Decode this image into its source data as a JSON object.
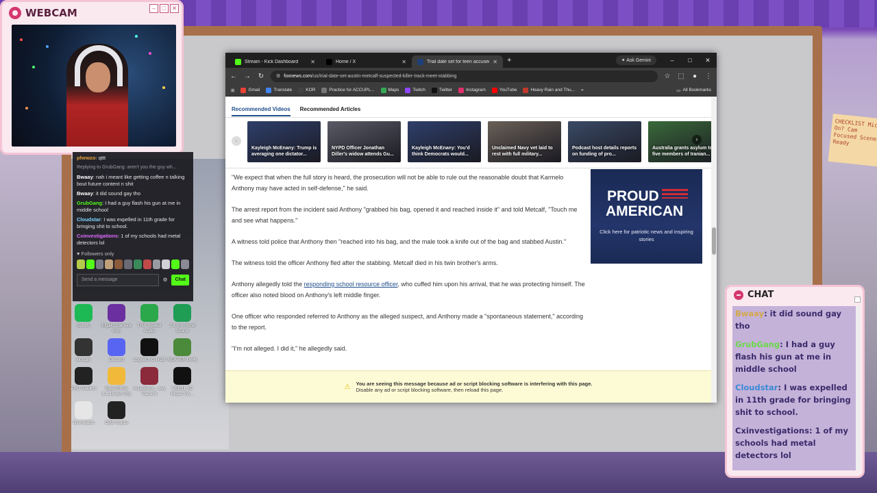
{
  "webcam": {
    "title": "WEBCAM"
  },
  "obs_chat": {
    "messages": [
      {
        "user": "phewzo",
        "text": "qttt",
        "color": "#e9a23b"
      },
      {
        "reply": "Replying to GrubGang: aren't you the guy wh..."
      },
      {
        "user": "Bwaay",
        "text": "nah i meant like getting coffee n talking bout future content n shit",
        "color": "#ffffff"
      },
      {
        "user": "Bwaay",
        "text": "it did sound gay tho",
        "color": "#ffffff"
      },
      {
        "user": "GrubGang",
        "text": "I had a guy flash his gun at me in middle school",
        "color": "#53fc18"
      },
      {
        "user": "Cloudstar",
        "text": "I was expelled in 11th grade for bringing shit to school.",
        "color": "#7fd6ff"
      },
      {
        "user": "Cxinvestigations",
        "text": "1 of my schools had metal detectors lol",
        "color": "#e06bff"
      }
    ],
    "followers_only": "Followers only",
    "send_placeholder": "Send a message",
    "chat_button": "Chat"
  },
  "desktop_icons": [
    {
      "label": "Spotify",
      "color": "#1db954"
    },
    {
      "label": "Elgato Camera Hub",
      "color": "#6b2fa0"
    },
    {
      "label": "THX Spatial Audio",
      "color": "#2aa84a"
    },
    {
      "label": "7.1 Surround Sound",
      "color": "#1f9d55"
    },
    {
      "label": "kicktalk",
      "color": "#333"
    },
    {
      "label": "Discord",
      "color": "#5865f2"
    },
    {
      "label": "Logitech G HUB",
      "color": "#111"
    },
    {
      "label": "REAPER (x64)",
      "color": "#4a8a3a"
    },
    {
      "label": "ARC Raiders",
      "color": "#222"
    },
    {
      "label": "OpenOffice 4.1.16 (en-US)",
      "color": "#f0b93a"
    },
    {
      "label": "re:jackbox... any Pack III",
      "color": "#8a2a3a"
    },
    {
      "label": "VBE31 3D Music Vis...",
      "color": "#111"
    },
    {
      "label": "Overwatch",
      "color": "#e6e6e6"
    },
    {
      "label": "OBS Studio",
      "color": "#222"
    }
  ],
  "browser": {
    "tabs": [
      {
        "label": "Stream - Kick Dashboard",
        "fav": "#53fc18"
      },
      {
        "label": "Home / X",
        "fav": "#000000"
      },
      {
        "label": "Trial date set for teen accused",
        "fav": "#1f3f7a"
      }
    ],
    "new_tab": "+",
    "ask_gemini": "Ask Gemini",
    "url_host": "foxnews.com",
    "url_path": "/us/trial-date-set-austin-metcalf-suspected-killer-track-meet-stabbing",
    "bookmarks": [
      {
        "label": "Gmail",
        "color": "#ea4335"
      },
      {
        "label": "Translate",
        "color": "#4285f4"
      },
      {
        "label": "KOR",
        "color": "#444"
      },
      {
        "label": "Practice for ACCUPL...",
        "color": "#777"
      },
      {
        "label": "Maps",
        "color": "#34a853"
      },
      {
        "label": "Twitch",
        "color": "#9146ff"
      },
      {
        "label": "Twitter",
        "color": "#111"
      },
      {
        "label": "Instagram",
        "color": "#e1306c"
      },
      {
        "label": "YouTube",
        "color": "#ff0000"
      },
      {
        "label": "Heavy Rain and Thu...",
        "color": "#c0392b"
      }
    ],
    "all_bookmarks": "All Bookmarks"
  },
  "page": {
    "rec_tabs": [
      "Recommended Videos",
      "Recommended Articles"
    ],
    "videos": [
      {
        "caption": "Kayleigh McEnany: Trump is averaging one dictator...",
        "color": "#2f3f6a"
      },
      {
        "caption": "NYPD Officer Jonathan Diller's widow attends Gu...",
        "color": "#5a5a66"
      },
      {
        "caption": "Kayleigh McEnany: You'd think Democrats would...",
        "color": "#2f3f6a"
      },
      {
        "caption": "Unclaimed Navy vet laid to rest with full military...",
        "color": "#6a6058"
      },
      {
        "caption": "Podcast host details reports on funding of pro...",
        "color": "#3a4a66"
      },
      {
        "caption": "Australia grants asylum to five members of Iranian...",
        "color": "#3a6a3a"
      }
    ],
    "paragraphs": [
      "\"We expect that when the full story is heard, the prosecution will not be able to rule out the reasonable doubt that Karmelo Anthony may have acted in self-defense,\" he said.",
      "The arrest report from the incident said Anthony \"grabbed his bag, opened it and reached inside it\" and told Metcalf, \"Touch me and see what happens.\"",
      "A witness told police that Anthony then \"reached into his bag, and the male took a knife out of the bag and stabbed Austin.\"",
      "The witness told the officer Anthony fled after the stabbing. Metcalf died in his twin brother's arms.",
      "One officer who responded referred to Anthony as the alleged suspect, and Anthony made a \"spontaneous statement,\" according to the report.",
      "\"I'm not alleged. I did it,\" he allegedly said."
    ],
    "p5_pre": "Anthony allegedly told the ",
    "p5_link": "responding school resource officer",
    "p5_post": ", who cuffed him upon his arrival, that he was protecting himself. The officer also noted blood on Anthony's left middle finger.",
    "ad": {
      "line1": "PROUD",
      "line2": "AMERICAN",
      "sub": "Click here for patriotic news and inspiring stories"
    },
    "adblock": {
      "line1": "You are seeing this message because ad or script blocking software is interfering with this page.",
      "line2": "Disable any ad or script blocking software, then reload this page."
    }
  },
  "right_chat": {
    "title": "CHAT",
    "messages": [
      {
        "user": "Bwaay",
        "text": "it did sound gay tho",
        "color": "#d3a94a"
      },
      {
        "user": "GrubGang",
        "text": "I had a guy flash his gun at me in middle school",
        "color": "#6bd84a"
      },
      {
        "user": "Cloudstar",
        "text": "I was expelled in 11th grade for bringing shit to school.",
        "color": "#3a8ad6"
      },
      {
        "user": "Cxinvestigations",
        "text": "1 of my schools had metal detectors lol",
        "color": "#3a2a6a"
      }
    ]
  },
  "sticky_note": "CHECKLIST Mic On? Cam Focused Scenes Ready"
}
